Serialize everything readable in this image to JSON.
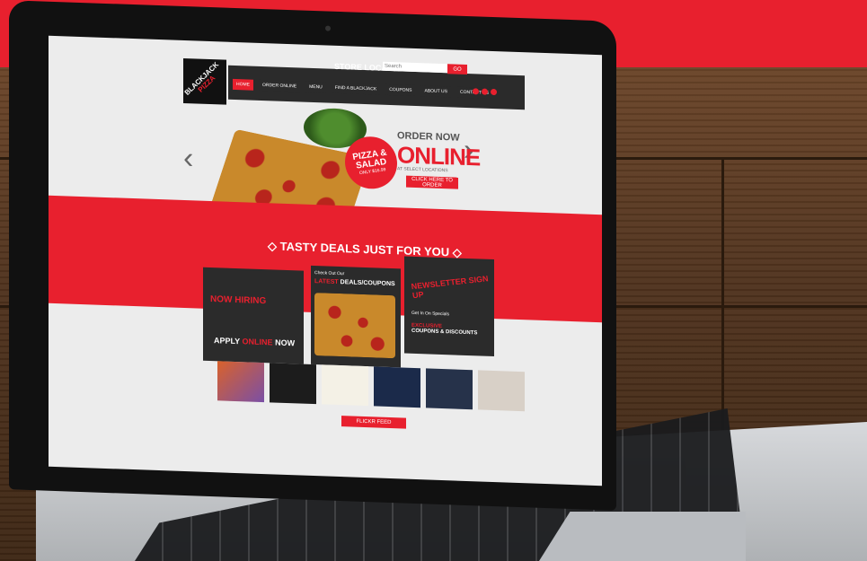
{
  "site": {
    "logo": {
      "line1": "BLACKJACK",
      "line2": "PIZZA"
    },
    "store_locator": "STORE LOCATOR",
    "search_placeholder": "Search",
    "search_button": "GO",
    "nav": [
      {
        "label": "HOME",
        "active": true
      },
      {
        "label": "ORDER ONLINE",
        "active": false
      },
      {
        "label": "MENU",
        "active": false
      },
      {
        "label": "FIND A BLACKJACK",
        "active": false
      },
      {
        "label": "COUPONS",
        "active": false
      },
      {
        "label": "ABOUT US",
        "active": false
      },
      {
        "label": "CONTACT US",
        "active": false
      }
    ],
    "hero": {
      "badge_line1": "PIZZA &",
      "badge_line2": "SALAD",
      "badge_small": "ONLY $16.99",
      "order_now": "ORDER NOW",
      "online": "ONLINE",
      "sub": "AT SELECT LOCATIONS",
      "button": "CLICK HERE TO ORDER"
    },
    "deals_title": "◇ TASTY DEALS JUST FOR YOU ◇",
    "cards": {
      "hiring": {
        "title": "NOW HIRING",
        "apply_prefix": "APPLY",
        "apply_word": "ONLINE",
        "apply_suffix": "NOW"
      },
      "coupons": {
        "line1": "Check Out Our",
        "line2_highlight": "LATEST",
        "line2_rest": "DEALS/COUPONS"
      },
      "newsletter": {
        "title": "NEWSLETTER SIGN UP",
        "line1": "Get In On Specials",
        "line2_highlight": "EXCLUSIVE",
        "line3": "COUPONS & DISCOUNTS"
      }
    },
    "flickr": "FLICKR FEED"
  },
  "colors": {
    "brand_red": "#e8202e",
    "dark": "#2b2b2b"
  }
}
